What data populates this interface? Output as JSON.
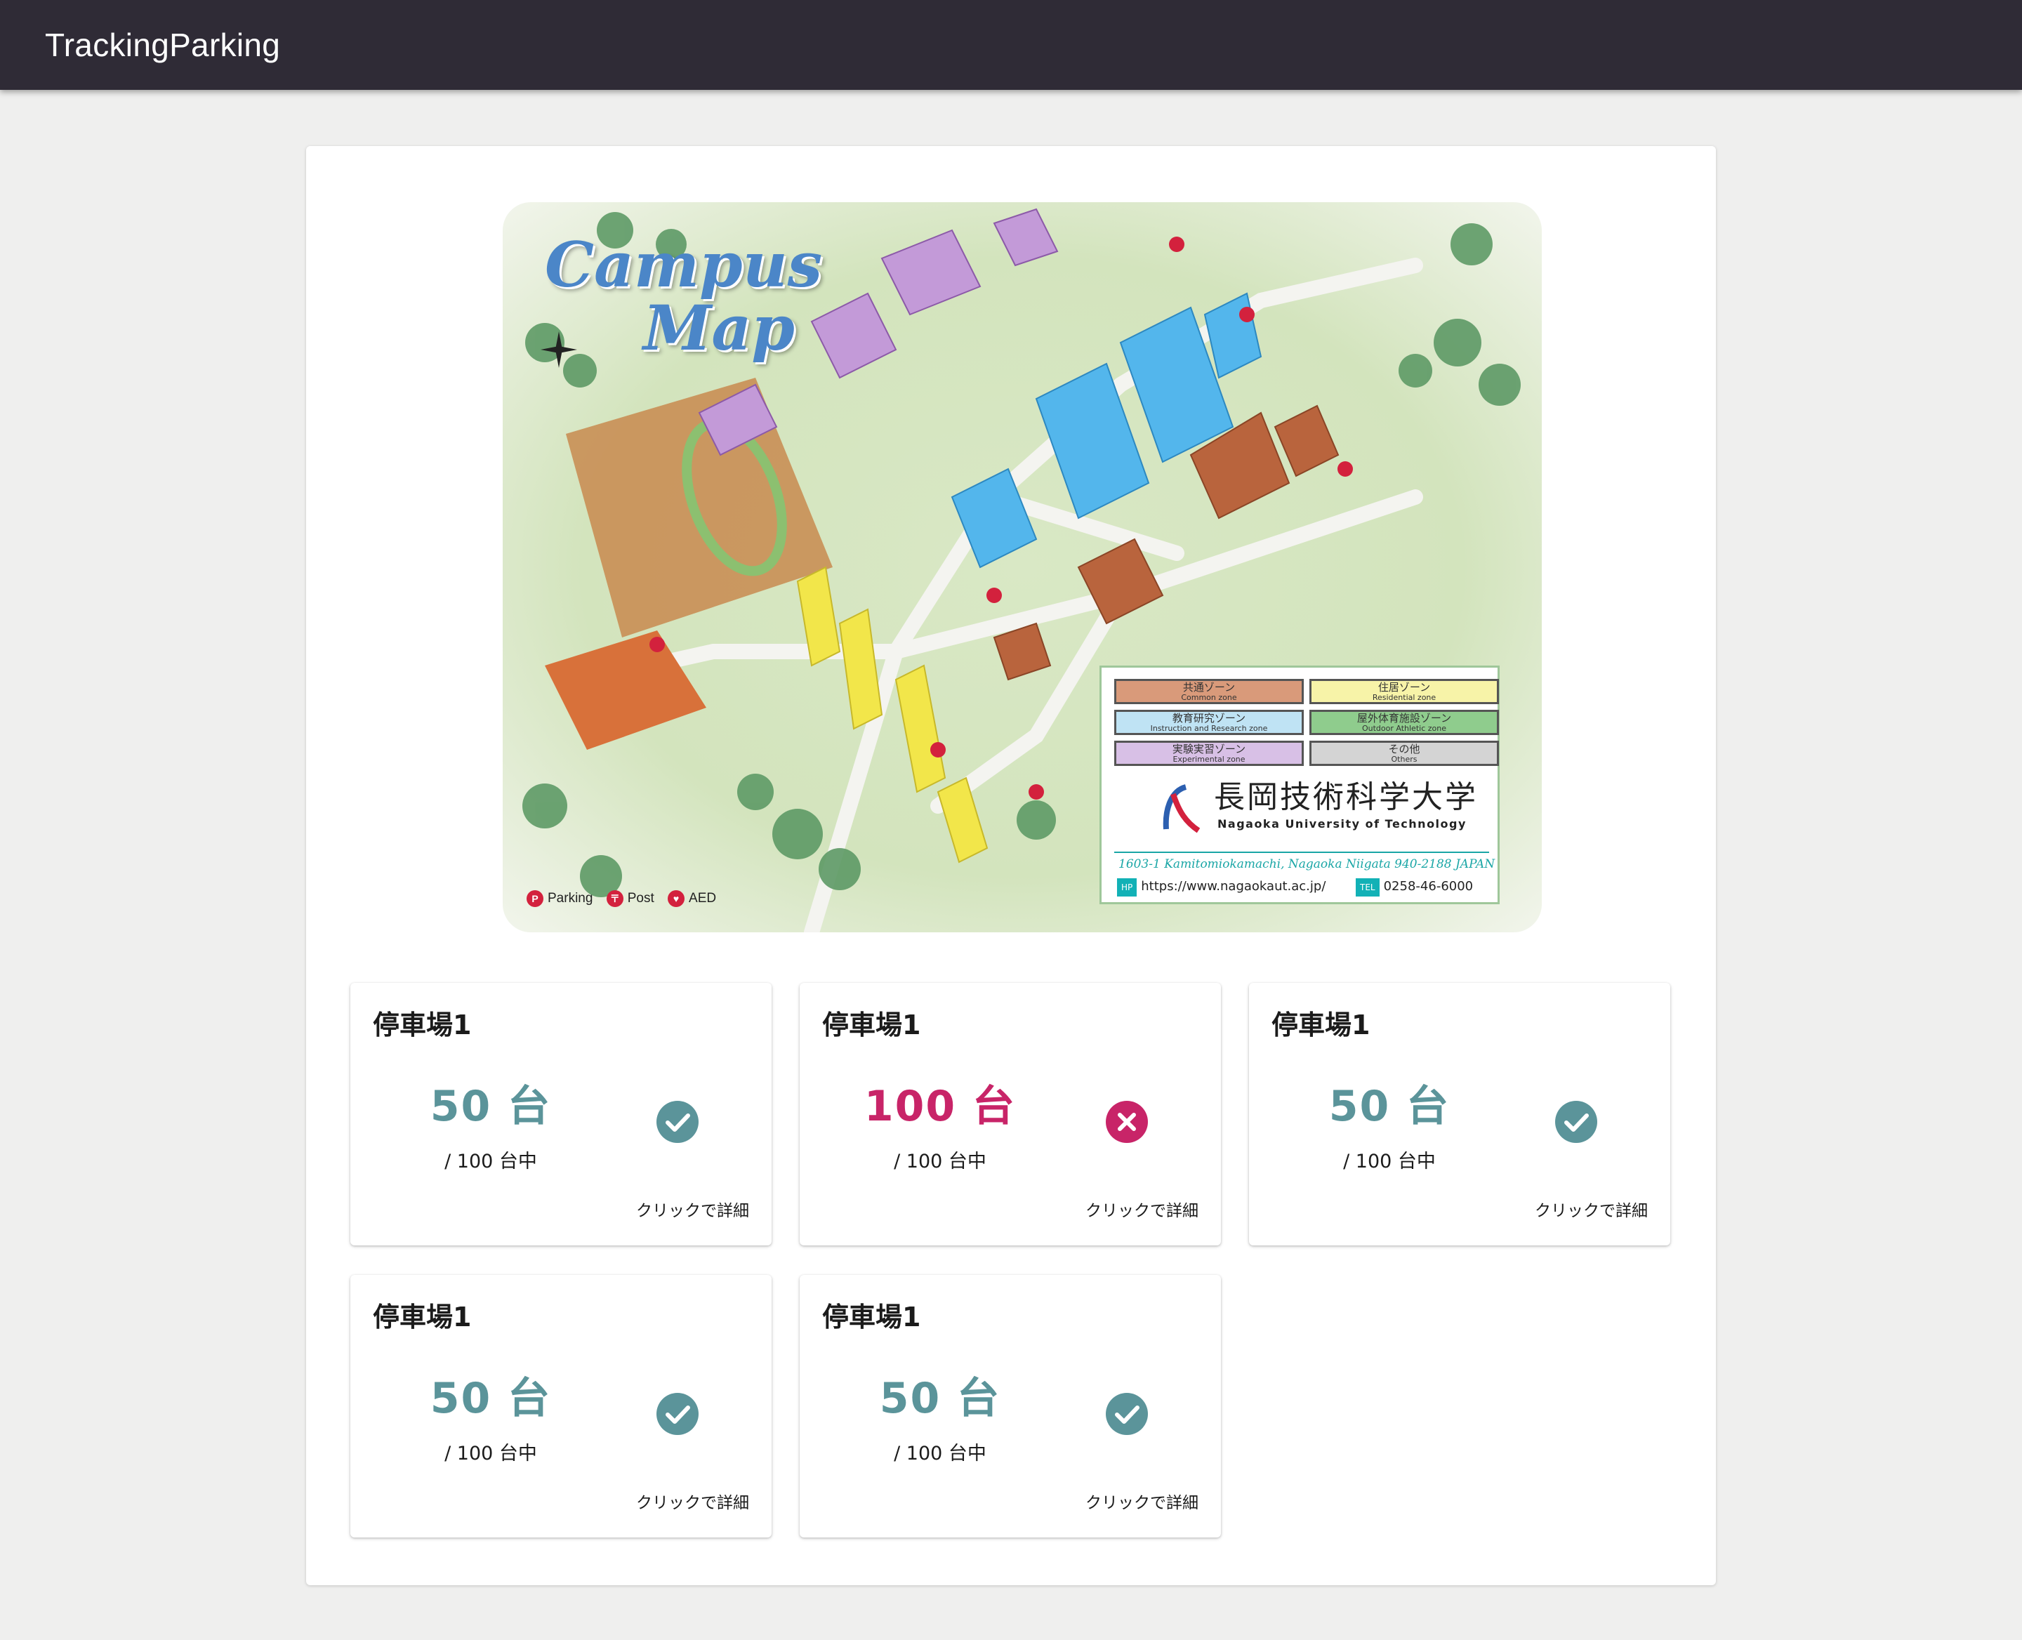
{
  "app": {
    "title": "TrackingParking"
  },
  "map": {
    "title_line1": "Campus",
    "title_line2": "Map",
    "zones": {
      "common_jp": "共通ゾーン",
      "common_en": "Common zone",
      "residential_jp": "住居ゾーン",
      "residential_en": "Residential zone",
      "instruction_jp": "教育研究ゾーン",
      "instruction_en": "Instruction and Research zone",
      "athletic_jp": "屋外体育施設ゾーン",
      "athletic_en": "Outdoor Athletic zone",
      "experimental_jp": "実験実習ゾーン",
      "experimental_en": "Experimental zone",
      "others_jp": "その他",
      "others_en": "Others"
    },
    "university_jp": "長岡技術科学大学",
    "university_en": "Nagaoka University of Technology",
    "address": "1603-1 Kamitomiokamachi, Nagaoka Niigata   940-2188 JAPAN",
    "hp_tag": "HP",
    "hp_url": "https://www.nagaokaut.ac.jp/",
    "tel_tag": "TEL",
    "tel": "0258-46-6000",
    "key_parking": "Parking",
    "key_post": "Post",
    "key_aed": "AED",
    "colors": {
      "common": "#d99a7a",
      "residential": "#f7f3a8",
      "instruction": "#bfe3f4",
      "athletic": "#8fcc8d",
      "experimental": "#d8c0e6",
      "others": "#d4d4d4"
    }
  },
  "cards": [
    {
      "title": "停車場1",
      "count": "50 台",
      "total": "/ 100 台中",
      "status": "available",
      "detail": "クリックで詳細"
    },
    {
      "title": "停車場1",
      "count": "100 台",
      "total": "/ 100 台中",
      "status": "full",
      "detail": "クリックで詳細"
    },
    {
      "title": "停車場1",
      "count": "50 台",
      "total": "/ 100 台中",
      "status": "available",
      "detail": "クリックで詳細"
    },
    {
      "title": "停車場1",
      "count": "50 台",
      "total": "/ 100 台中",
      "status": "available",
      "detail": "クリックで詳細"
    },
    {
      "title": "停車場1",
      "count": "50 台",
      "total": "/ 100 台中",
      "status": "available",
      "detail": "クリックで詳細"
    }
  ],
  "status_colors": {
    "available": "#5b949a",
    "full": "#c82468"
  },
  "icons": {
    "available": "check-circle-icon",
    "full": "close-circle-icon"
  }
}
